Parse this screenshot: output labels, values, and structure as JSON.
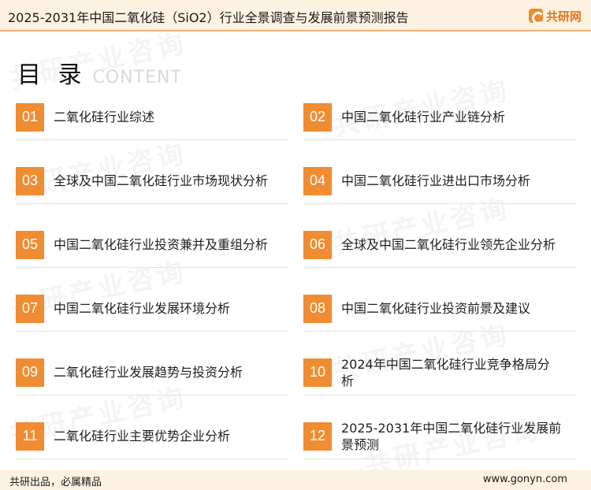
{
  "header": {
    "title": "2025-2031年中国二氧化硅（SiO2）行业全景调查与发展前景预测报告",
    "brand": "共研网"
  },
  "toc": {
    "title": "目 录",
    "subtitle": "CONTENT",
    "items": [
      {
        "num": "01",
        "label": "二氧化硅行业综述"
      },
      {
        "num": "02",
        "label": "中国二氧化硅行业产业链分析"
      },
      {
        "num": "03",
        "label": "全球及中国二氧化硅行业市场现状分析"
      },
      {
        "num": "04",
        "label": "中国二氧化硅行业进出口市场分析"
      },
      {
        "num": "05",
        "label": "中国二氧化硅行业投资兼并及重组分析"
      },
      {
        "num": "06",
        "label": "全球及中国二氧化硅行业领先企业分析"
      },
      {
        "num": "07",
        "label": "中国二氧化硅行业发展环境分析"
      },
      {
        "num": "08",
        "label": "中国二氧化硅行业投资前景及建议"
      },
      {
        "num": "09",
        "label": "二氧化硅行业发展趋势与投资分析"
      },
      {
        "num": "10",
        "label": "2024年中国二氧化硅行业竞争格局分析"
      },
      {
        "num": "11",
        "label": "二氧化硅行业主要优势企业分析"
      },
      {
        "num": "12",
        "label": "2025-2031年中国二氧化硅行业发展前景预测"
      }
    ]
  },
  "footer": {
    "slogan": "共研出品，必属精品",
    "url": "www.gonyn.com"
  }
}
